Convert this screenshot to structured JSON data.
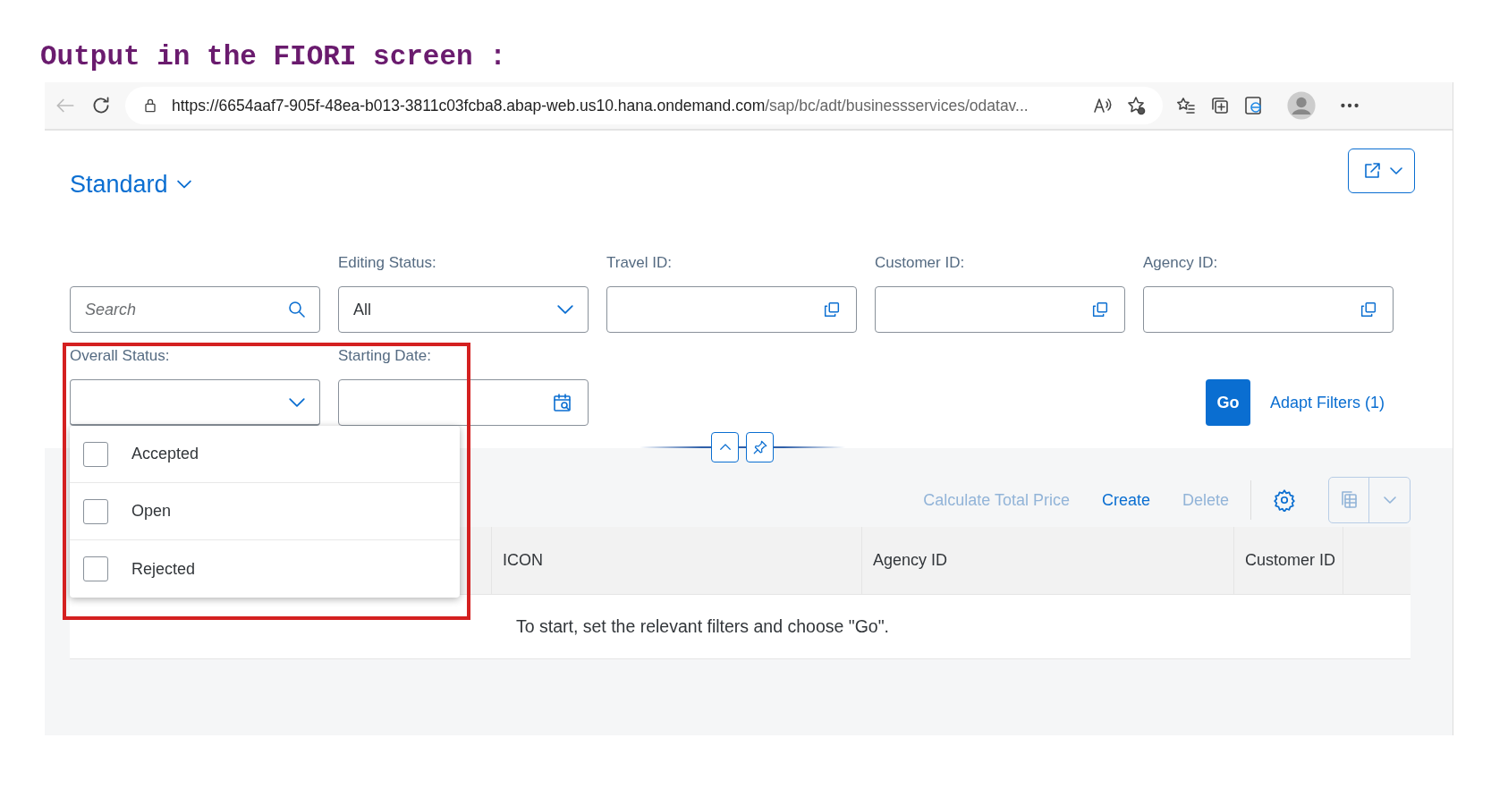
{
  "heading": "Output in the FIORI screen :",
  "browser": {
    "url_host": "https://6654aaf7-905f-48ea-b013-3811c03fcba8.abap-web.us10.hana.ondemand.com",
    "url_path": "/sap/bc/adt/businessservices/odatav..."
  },
  "variant": {
    "title": "Standard"
  },
  "filters": [
    {
      "kind": "search",
      "placeholder": "Search"
    },
    {
      "kind": "select",
      "label": "Editing Status:",
      "value": "All"
    },
    {
      "kind": "value_help",
      "label": "Travel ID:"
    },
    {
      "kind": "value_help",
      "label": "Customer ID:"
    },
    {
      "kind": "value_help",
      "label": "Agency ID:"
    },
    {
      "kind": "select",
      "label": "Overall Status:",
      "expanded": true,
      "options": [
        {
          "label": "Accepted",
          "checked": false
        },
        {
          "label": "Open",
          "checked": false
        },
        {
          "label": "Rejected",
          "checked": false
        }
      ]
    },
    {
      "kind": "date",
      "label": "Starting Date:"
    }
  ],
  "go_button": "Go",
  "adapt_filters": "Adapt Filters (1)",
  "toolbar": [
    {
      "label": "Calculate Total Price",
      "disabled": true
    },
    {
      "label": "Create",
      "disabled": false
    },
    {
      "label": "Delete",
      "disabled": true
    }
  ],
  "table": {
    "columns": [
      "ICON",
      "Agency ID",
      "Customer ID"
    ],
    "empty_text": "To start, set the relevant filters and choose \"Go\"."
  }
}
